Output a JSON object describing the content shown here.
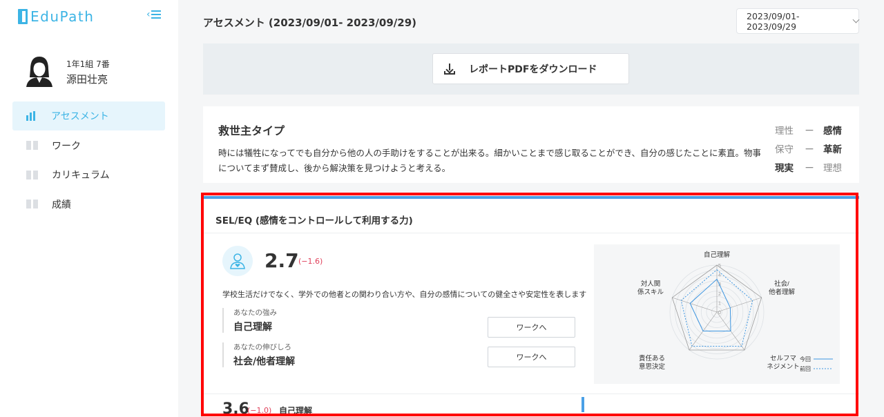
{
  "app": {
    "logo_text": "EduPath",
    "accent_color": "#3cb4e5"
  },
  "student": {
    "class_info": "1年1組 7番",
    "name": "源田壮亮"
  },
  "sidebar": {
    "items": [
      {
        "label": "アセスメント",
        "icon": "bar-chart-icon",
        "active": true
      },
      {
        "label": "ワーク",
        "icon": "book-icon",
        "active": false
      },
      {
        "label": "カリキュラム",
        "icon": "book-icon",
        "active": false
      },
      {
        "label": "成績",
        "icon": "book-icon",
        "active": false
      }
    ]
  },
  "header": {
    "title": "アセスメント (2023/09/01- 2023/09/29)",
    "date_range_selected": "2023/09/01-2023/09/29"
  },
  "download": {
    "label": "レポートPDFをダウンロード"
  },
  "type_card": {
    "title": "救世主タイプ",
    "description": "時には犠牲になってでも自分から他の人の手助けをすることが出来る。細かいことまで感じ取ることができ、自分の感じたことに素直。物事についてまず賛成し、後から解決策を見つけようと考える。",
    "traits": [
      {
        "left": "理性",
        "dash": "ー",
        "right": "感情",
        "emphasis": "right"
      },
      {
        "left": "保守",
        "dash": "ー",
        "right": "革新",
        "emphasis": "right"
      },
      {
        "left": "現実",
        "dash": "ー",
        "right": "理想",
        "emphasis": "left"
      }
    ]
  },
  "sel_card": {
    "title": "SEL/EQ (感情をコントロールして利用する力)",
    "score": "2.7",
    "delta": "(−1.6)",
    "description": "学校生活だけでなく、学外での他者との関わり合い方や、自分の感情についての健全さや安定性を表します",
    "strength": {
      "label": "あなたの強み",
      "value": "自己理解",
      "button": "ワークへ"
    },
    "growth": {
      "label": "あなたの伸びしろ",
      "value": "社会/他者理解",
      "button": "ワークへ"
    },
    "radar": {
      "axes": [
        "自己理解",
        "社会/\n他者理解",
        "セルフマ\nネジメント",
        "責任ある\n意思決定",
        "対人関\n係スキル"
      ],
      "ticks": [
        "5",
        "4",
        "3",
        "2",
        "1",
        "0"
      ],
      "legend_current": "今回",
      "legend_previous": "前回",
      "current_values": [
        3.5,
        1.5,
        2.5,
        2.5,
        3.0
      ],
      "previous_values": [
        4.5,
        4.0,
        4.5,
        4.5,
        4.0
      ],
      "max": 5
    },
    "sub_row": {
      "score": "3.6",
      "delta": "(−1.0)",
      "label": "自己理解"
    }
  },
  "highlight_color": "#ff0000"
}
